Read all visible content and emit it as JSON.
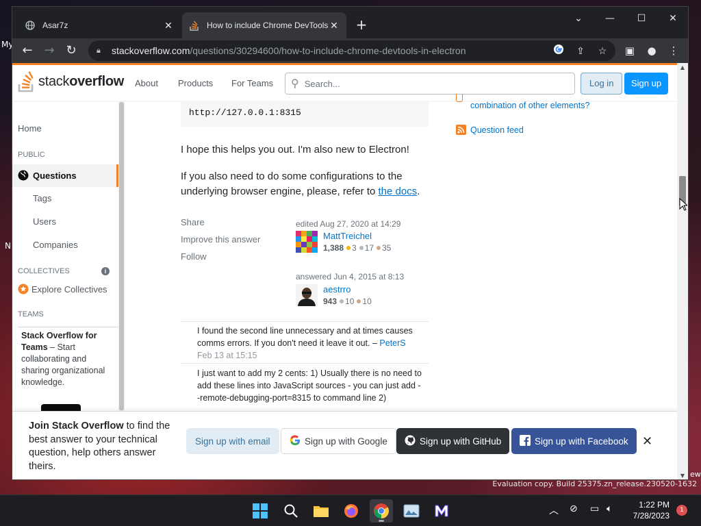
{
  "desktop": {
    "bits": [
      "My",
      "N",
      "ew"
    ],
    "watermark": "Evaluation copy. Build 25375.zn_release.230520-1632"
  },
  "browser": {
    "tabs": [
      {
        "title": "Asar7z",
        "icon": "globe-icon",
        "active": false
      },
      {
        "title": "How to include Chrome DevTools in Electron",
        "icon": "stackoverflow-icon",
        "active": true
      }
    ],
    "url_host": "stackoverflow.com",
    "url_path": "/questions/30294600/how-to-include-chrome-devtools-in-electron"
  },
  "so": {
    "logo_text_a": "stack",
    "logo_text_b": "overflow",
    "nav": [
      "About",
      "Products",
      "For Teams"
    ],
    "search_placeholder": "Search...",
    "login": "Log in",
    "signup": "Sign up"
  },
  "left_nav": {
    "home": "Home",
    "public": "PUBLIC",
    "questions": "Questions",
    "tags": "Tags",
    "users": "Users",
    "companies": "Companies",
    "collectives": "COLLECTIVES",
    "explore": "Explore Collectives",
    "teams": "TEAMS",
    "teams_title": "Stack Overflow for Teams",
    "teams_text": " – Start collaborating and sharing organizational knowledge."
  },
  "answer": {
    "code_tail": "http://127.0.0.1:8315",
    "p1": "I hope this helps you out. I'm also new to Electron!",
    "p2_a": "If you also need to do some configurations to the",
    "p2_b": "underlying browser engine, please, refer to ",
    "p2_link": "the docs",
    "p2_end": ".",
    "menu": [
      "Share",
      "Improve this answer",
      "Follow"
    ],
    "edited_label": "edited Aug 27, 2020 at 14:29",
    "editor_name": "MattTreichel",
    "editor_rep": "1,388",
    "editor_gold": "3",
    "editor_silver": "17",
    "editor_bronze": "35",
    "answered_label": "answered Jun 4, 2015 at 8:13",
    "author_name": "aestrro",
    "author_rep": "943",
    "author_silver": "10",
    "author_bronze": "10"
  },
  "comments": [
    {
      "text": "I found the second line unnecessary and at times causes comms errors. If you don't need it leave it out. – ",
      "user": "PeterS",
      "date": "Feb 13 at 15:15"
    },
    {
      "text": "I just want to add my 2 cents: 1) Usually there is no need to add these lines into JavaScript sources - you can just add --remote-debugging-port=8315 to command line 2)"
    }
  ],
  "right_sidebar": {
    "partial_link": "combination of other elements?",
    "feed": "Question feed"
  },
  "join_banner": {
    "bold": "Join Stack Overflow",
    "rest": " to find the best answer to your technical question, help others answer theirs.",
    "email": "Sign up with email",
    "google": "Sign up with Google",
    "github": "Sign up with GitHub",
    "facebook": "Sign up with Facebook"
  },
  "taskbar": {
    "time": "1:22 PM",
    "date": "7/28/2023",
    "notifications": "1"
  },
  "colors": {
    "so_orange": "#f48225",
    "so_blue": "#0074cc",
    "signup_blue": "#0a95ff",
    "chrome_dark": "#202124"
  }
}
